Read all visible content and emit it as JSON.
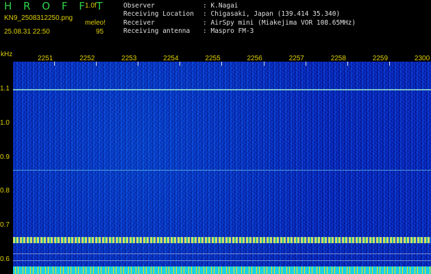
{
  "header": {
    "app_title": "H R O F F T",
    "scale": "1.0",
    "scale_suffix": "f",
    "filename": "KN9_2508312250.png",
    "meleo": "meleo!",
    "datetime": "25.08.31 22:50",
    "count": "95"
  },
  "info": [
    {
      "key": "Observer",
      "sep": ":",
      "value": "K.Nagai"
    },
    {
      "key": "Receiving Location",
      "sep": ":",
      "value": "Chigasaki, Japan (139.414 35.340)"
    },
    {
      "key": "Receiver",
      "sep": ":",
      "value": "AirSpy mini (Miakejima VOR 108.65MHz)"
    },
    {
      "key": "Receiving antenna",
      "sep": ":",
      "value": "Maspro FM-3"
    }
  ],
  "spectrogram": {
    "unit": "kHz",
    "time_ticks": [
      "2251",
      "2252",
      "2253",
      "2254",
      "2255",
      "2256",
      "2257",
      "2258",
      "2259",
      "2300"
    ],
    "freq_ticks": [
      "1.1",
      "1.0",
      "0.9",
      "0.8",
      "0.7",
      "0.6"
    ],
    "lines": [
      {
        "freq_khz": 1.1,
        "color": "#9ef0d0",
        "strength": 0.7
      },
      {
        "freq_khz": 0.865,
        "color": "#6fd4e8",
        "strength": 0.4
      },
      {
        "freq_khz": 0.66,
        "color": "#e8f05a",
        "strength": 1.0
      },
      {
        "freq_khz": 0.62,
        "color": "#aab4e0",
        "strength": 0.5
      },
      {
        "freq_khz": 0.6,
        "color": "#aab4e0",
        "strength": 0.5
      }
    ],
    "bottom_strip_colors": [
      "#1bd0e6",
      "#f2e500"
    ]
  }
}
